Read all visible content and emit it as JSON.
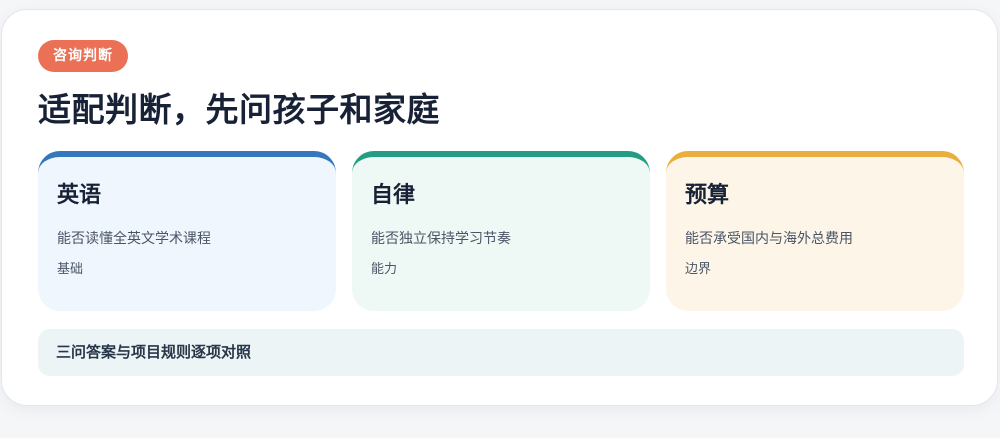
{
  "tag": "咨询判断",
  "title": "适配判断，先问孩子和家庭",
  "cards": [
    {
      "title": "英语",
      "desc": "能否读懂全英文学术课程",
      "tail": "基础",
      "accent": "#3477bb",
      "background": "#f0f6fe"
    },
    {
      "title": "自律",
      "desc": "能否独立保持学习节奏",
      "tail": "能力",
      "accent": "#239e82",
      "background": "#eef8f5"
    },
    {
      "title": "预算",
      "desc": "能否承受国内与海外总费用",
      "tail": "边界",
      "accent": "#e9ae3c",
      "background": "#fdf6e8"
    }
  ],
  "footer": "三问答案与项目规则逐项对照",
  "colors": {
    "tag_background": "#ea7156",
    "title_text": "#182236",
    "footer_background": "#ecf4f5"
  }
}
